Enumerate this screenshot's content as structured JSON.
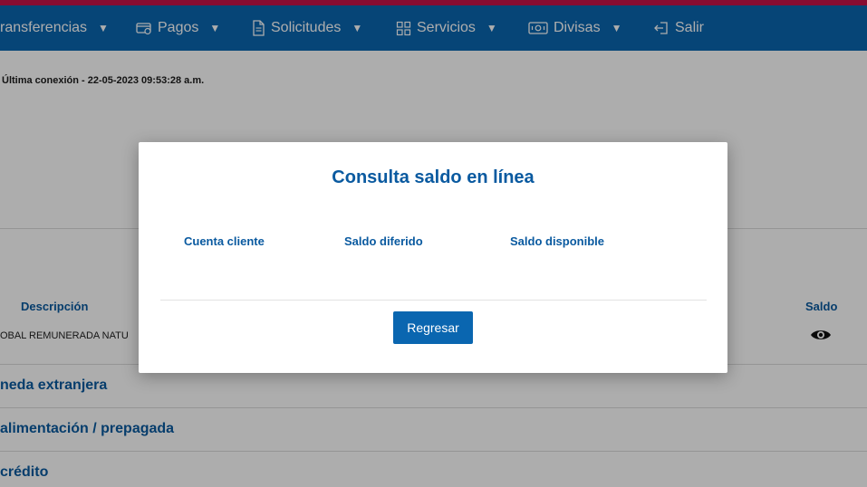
{
  "nav": {
    "items": [
      {
        "label": "ransferencias",
        "caret": "▼"
      },
      {
        "label": "Pagos",
        "caret": "▼",
        "icon": "payment-icon"
      },
      {
        "label": "Solicitudes",
        "caret": "▼",
        "icon": "document-icon"
      },
      {
        "label": "Servicios",
        "caret": "▼",
        "icon": "grid-icon"
      },
      {
        "label": "Divisas",
        "caret": "▼",
        "icon": "currency-icon"
      },
      {
        "label": "Salir",
        "icon": "logout-icon"
      }
    ]
  },
  "page": {
    "last_login": "Última conexión - 22-05-2023 09:53:28 a.m.",
    "table": {
      "headers": {
        "description": "Descripción",
        "balance": "Saldo"
      },
      "rows": [
        {
          "description": "OBAL REMUNERADA NATU"
        }
      ]
    },
    "sections": [
      "neda extranjera",
      "alimentación / prepagada",
      "crédito"
    ]
  },
  "modal": {
    "title": "Consulta saldo en línea",
    "columns": [
      "Cuenta cliente",
      "Saldo diferido",
      "Saldo disponible"
    ],
    "back_label": "Regresar"
  },
  "colors": {
    "primary": "#0a66b0",
    "accent": "#c8124a",
    "heading": "#0a5aa0"
  }
}
